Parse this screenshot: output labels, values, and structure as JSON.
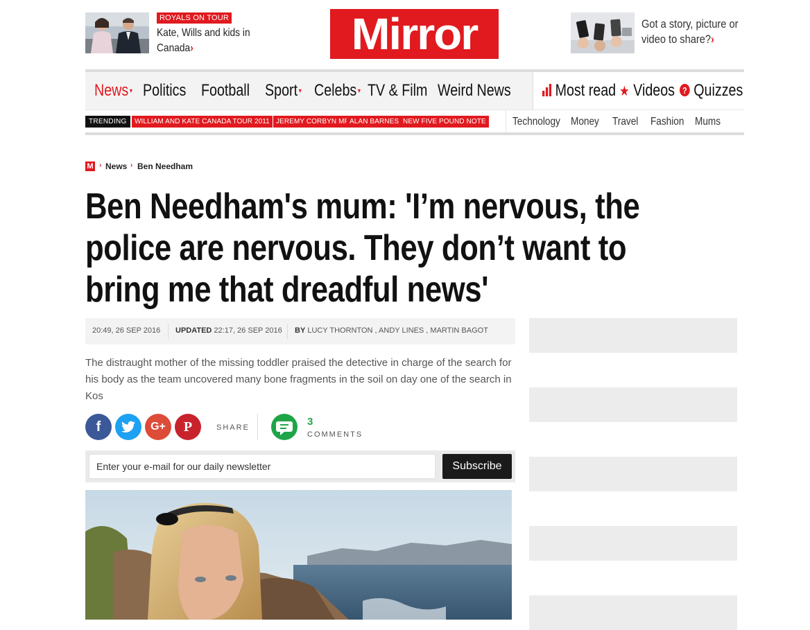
{
  "header": {
    "promo_left": {
      "badge": "ROYALS ON TOUR",
      "text": "Kate, Wills and kids in Canada"
    },
    "logo_text": "Mirror",
    "promo_right": {
      "text": "Got a story, picture or video to share?"
    }
  },
  "nav": {
    "primary": [
      {
        "label": "News",
        "dropdown": true,
        "active": true
      },
      {
        "label": "Politics"
      },
      {
        "label": "Football"
      },
      {
        "label": "Sport",
        "dropdown": true
      },
      {
        "label": "Celebs",
        "dropdown": true
      },
      {
        "label": "TV & Film"
      },
      {
        "label": "Weird News"
      }
    ],
    "right": [
      {
        "label": "Most read",
        "icon": "bar-chart-icon"
      },
      {
        "label": "Videos",
        "icon": "star-icon"
      },
      {
        "label": "Quizzes",
        "icon": "question-icon"
      }
    ],
    "trending_label": "TRENDING",
    "trending": [
      "WILLIAM AND KATE CANADA TOUR 2011",
      "JEREMY CORBYN MP",
      "ALAN BARNES",
      "NEW FIVE POUND NOTE"
    ],
    "secondary": [
      "Technology",
      "Money",
      "Travel",
      "Fashion",
      "Mums"
    ]
  },
  "breadcrumb": {
    "logo": "M",
    "items": [
      "News",
      "Ben Needham"
    ]
  },
  "article": {
    "headline": "Ben Needham's mum: 'I’m nervous, the police are nervous. They don’t want to bring me that dreadful news'",
    "published": "20:49, 26 SEP 2016",
    "updated_label": "UPDATED",
    "updated": "22:17, 26 SEP 2016",
    "by_label": "BY",
    "authors": "LUCY THORNTON , ANDY LINES , MARTIN BAGOT",
    "standfirst": "The distraught mother of the missing toddler praised the detective in charge of the search for his body as the team uncovered many bone fragments in the soil on day one of the search in Kos"
  },
  "share": {
    "label": "SHARE",
    "buttons": [
      {
        "name": "facebook",
        "glyph": "f",
        "color": "#3b5998"
      },
      {
        "name": "twitter",
        "glyph": "t",
        "color": "#1da1f2"
      },
      {
        "name": "google-plus",
        "glyph": "G+",
        "color": "#dd4b39"
      },
      {
        "name": "pinterest",
        "glyph": "P",
        "color": "#c8232c"
      }
    ],
    "comments_count": "3",
    "comments_label": "COMMENTS"
  },
  "newsletter": {
    "placeholder": "Enter your e-mail for our daily newsletter",
    "button": "Subscribe"
  },
  "colors": {
    "brand_red": "#e01a1f",
    "comment_green": "#1fa548"
  }
}
